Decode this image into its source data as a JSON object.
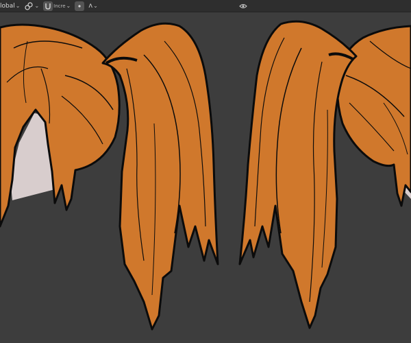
{
  "header": {
    "transform_orientation": "lobal",
    "snap_label": "Incre",
    "falloff_label": "ʌ"
  },
  "viewport": {
    "background": "#3d3d3d",
    "hair_color": "#d0782c",
    "outline_color": "#0b0b0b",
    "skin_color": "#d8cdcd"
  }
}
